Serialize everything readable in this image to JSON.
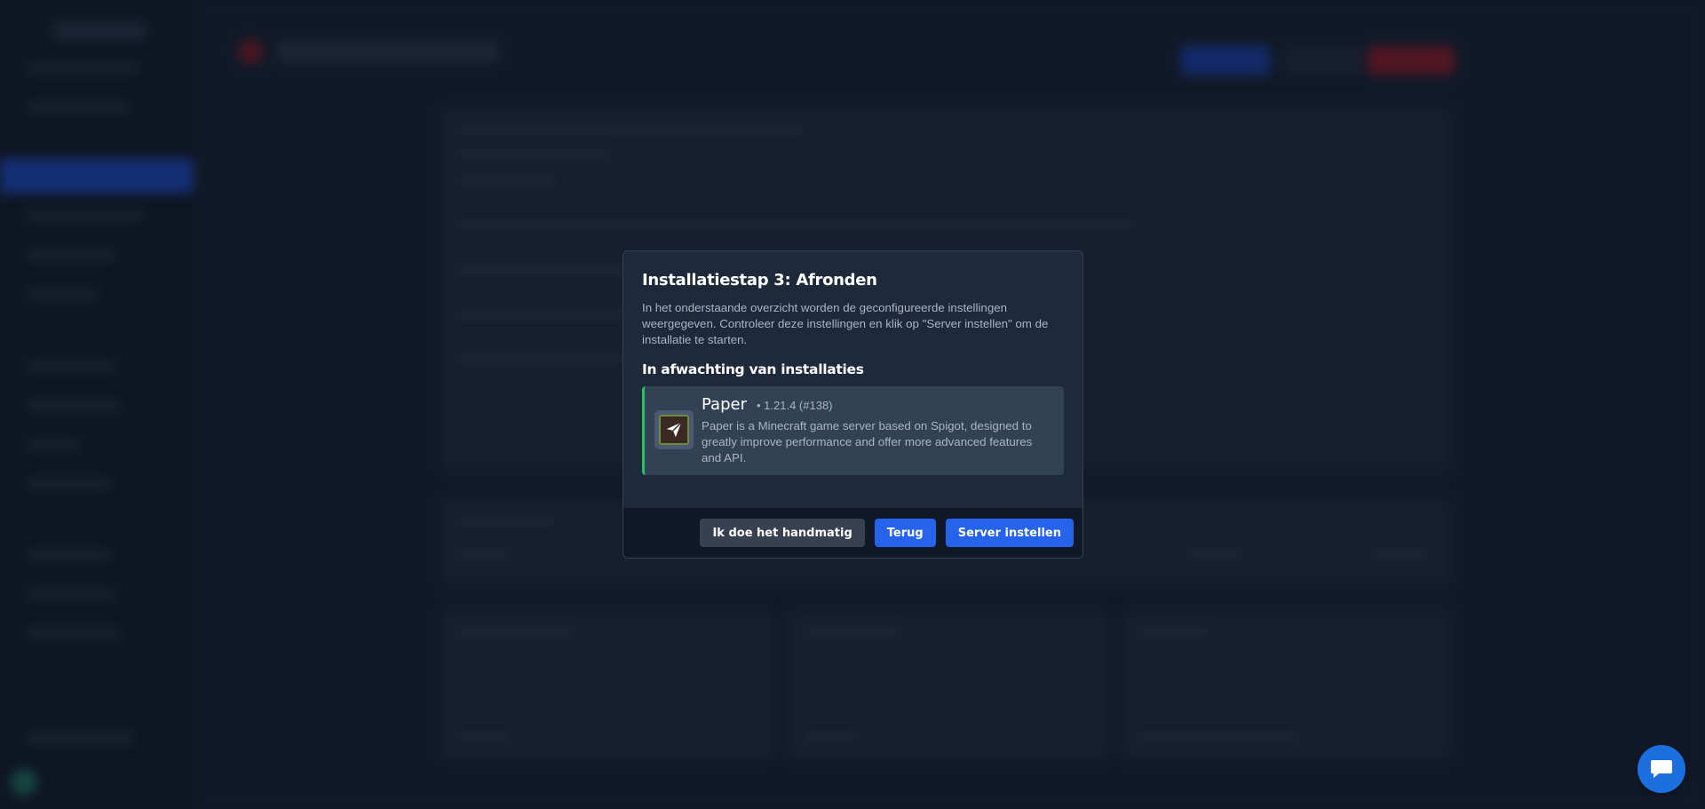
{
  "modal": {
    "title": "Installatiestap 3: Afronden",
    "description": "In het onderstaande overzicht worden de geconfigureerde instellingen weergegeven. Controleer deze instellingen en klik op \"Server instellen\" om de installatie te starten.",
    "section_title": "In afwachting van installaties",
    "package": {
      "name": "Paper",
      "version": "• 1.21.4 (#138)",
      "description": "Paper is a Minecraft game server based on Spigot, designed to greatly improve performance and offer more advanced features and API.",
      "icon": "paper-plane-icon"
    },
    "buttons": {
      "manual": "Ik doe het handmatig",
      "back": "Terug",
      "setup": "Server instellen"
    }
  },
  "chat": {
    "icon": "chat-bubble-icon"
  },
  "colors": {
    "accent": "#2563eb",
    "success": "#22c55e",
    "modal_bg": "#1e293b",
    "footer_bg": "#111827"
  }
}
